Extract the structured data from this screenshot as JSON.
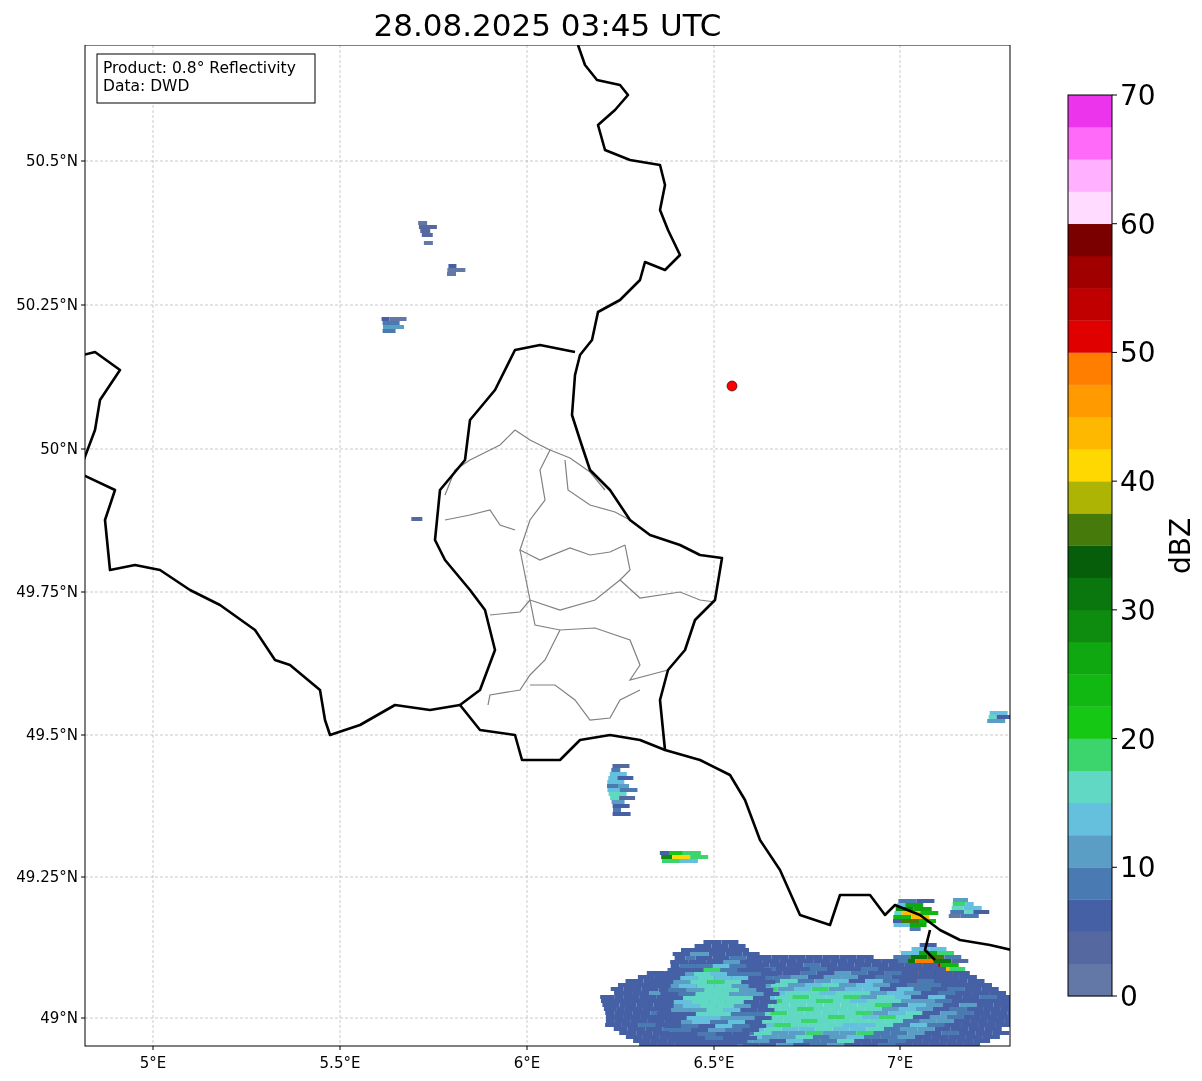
{
  "title": "28.08.2025 03:45 UTC",
  "info_box": [
    "Product: 0.8° Reflectivity",
    "Data: DWD"
  ],
  "map": {
    "y_ticks": [
      "50.5°N",
      "50.25°N",
      "50°N",
      "49.75°N",
      "49.5°N",
      "49.25°N",
      "49°N"
    ],
    "x_ticks": [
      "5°E",
      "5.5°E",
      "6°E",
      "6.5°E",
      "7°E"
    ]
  },
  "colorbar": {
    "label": "dBZ",
    "ticks": [
      "70",
      "60",
      "50",
      "40",
      "30",
      "20",
      "10",
      "0"
    ],
    "bins": [
      {
        "color": "#6478a8"
      },
      {
        "color": "#5668a0"
      },
      {
        "color": "#4560a4"
      },
      {
        "color": "#4a7ab2"
      },
      {
        "color": "#5a9ec6"
      },
      {
        "color": "#64c0dc"
      },
      {
        "color": "#60d8c4"
      },
      {
        "color": "#3cd46c"
      },
      {
        "color": "#14c814"
      },
      {
        "color": "#12b812"
      },
      {
        "color": "#10a810"
      },
      {
        "color": "#0e8c10"
      },
      {
        "color": "#0a760e"
      },
      {
        "color": "#075e0a"
      },
      {
        "color": "#467a0a"
      },
      {
        "color": "#aeb404"
      },
      {
        "color": "#fed800"
      },
      {
        "color": "#ffb800"
      },
      {
        "color": "#ff9a00"
      },
      {
        "color": "#ff7e00"
      },
      {
        "color": "#e00000"
      },
      {
        "color": "#c00000"
      },
      {
        "color": "#a00000"
      },
      {
        "color": "#7a0000"
      },
      {
        "color": "#ffdcff"
      },
      {
        "color": "#ffb0ff"
      },
      {
        "color": "#ff6af8"
      },
      {
        "color": "#ec34ec"
      }
    ]
  }
}
